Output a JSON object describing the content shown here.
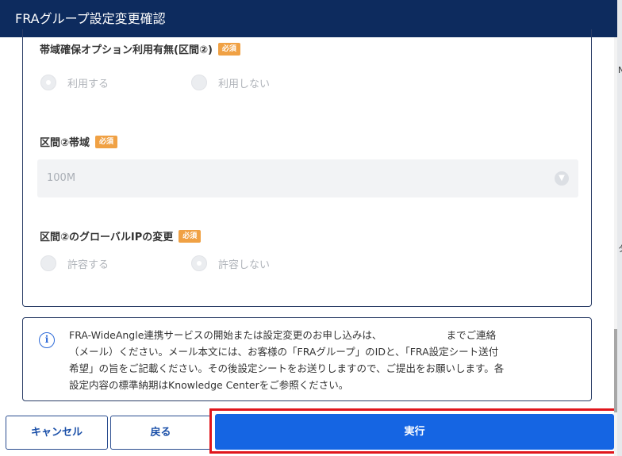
{
  "header": {
    "title": "FRAグループ設定変更確認"
  },
  "fields": {
    "bandwidth_option": {
      "label": "帯域確保オプション利用有無(区間②)",
      "badge": "必須",
      "options": [
        "利用する",
        "利用しない"
      ],
      "selected": "利用する"
    },
    "bandwidth": {
      "label": "区間②帯域",
      "badge": "必須",
      "value": "100M"
    },
    "global_ip": {
      "label": "区間②のグローバルIPの変更",
      "badge": "必須",
      "options": [
        "許容する",
        "許容しない"
      ],
      "selected": "許容しない"
    }
  },
  "info": {
    "lines": [
      "FRA-WideAngle連携サービスの開始または設定変更のお申し込みは、　　　　　　　までご連絡",
      "（メール）ください。メール本文には、お客様の「FRAグループ」のIDと、「FRA設定シート送付",
      "希望」の旨をご記載ください。その後設定シートをお送りしますので、ご提出をお願いします。各",
      "設定内容の標準納期はKnowledge Centerをご参照ください。"
    ]
  },
  "buttons": {
    "cancel": "キャンセル",
    "back": "戻る",
    "execute": "実行"
  },
  "background_fragments": [
    "N",
    "タ"
  ],
  "colors": {
    "header_bg": "#0d2b5e",
    "primary": "#1565e3",
    "badge": "#f0a144",
    "highlight": "#e0161c",
    "border": "#2a3d66"
  }
}
